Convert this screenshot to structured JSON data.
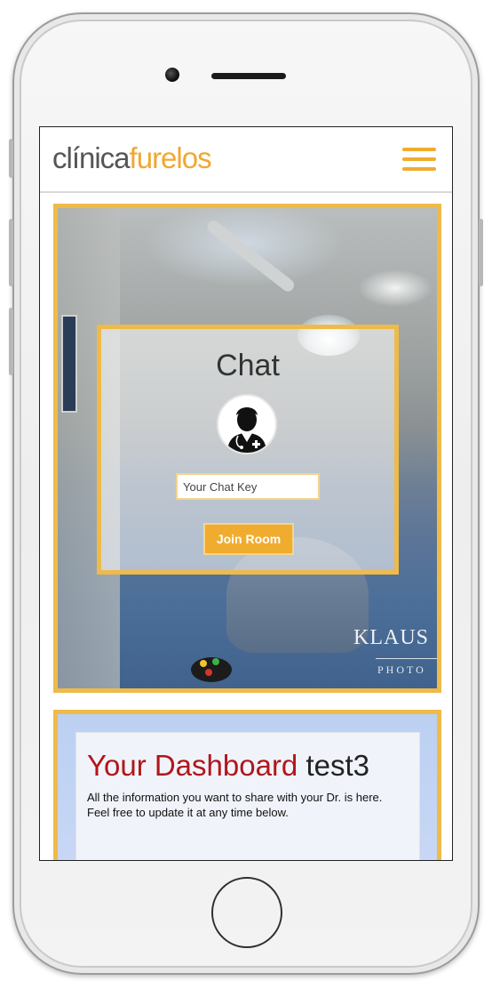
{
  "header": {
    "logo_part1": "clínica",
    "logo_part2": "furelos",
    "menu_icon": "hamburger-menu-icon"
  },
  "hero": {
    "watermark_line1": "KLAUS",
    "watermark_line2": "PHOTO"
  },
  "chat": {
    "title": "Chat",
    "avatar_icon": "doctor-avatar-icon",
    "input_placeholder": "Your Chat Key",
    "join_button": "Join Room"
  },
  "dashboard": {
    "title_part1": "Your Dashboard",
    "title_part2": "test3",
    "line1": "All the information you want to share with your Dr. is here.",
    "line2": "Feel free to update it at any time below."
  },
  "colors": {
    "accent": "#f0ac2e",
    "border": "#eebb4a",
    "dashboard_title_red": "#b0161b"
  }
}
